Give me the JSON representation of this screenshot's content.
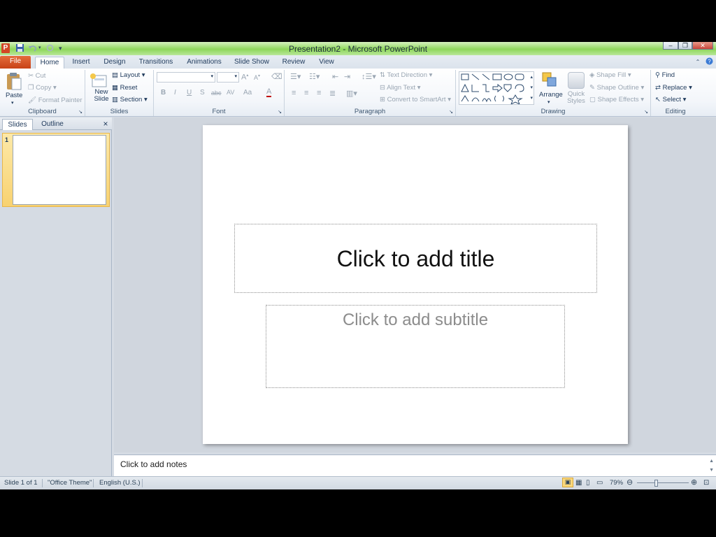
{
  "window": {
    "title": "Presentation2 - Microsoft PowerPoint"
  },
  "tabs": [
    "File",
    "Home",
    "Insert",
    "Design",
    "Transitions",
    "Animations",
    "Slide Show",
    "Review",
    "View"
  ],
  "ribbon": {
    "clipboard": {
      "label": "Clipboard",
      "paste": "Paste",
      "cut": "Cut",
      "copy": "Copy",
      "format_painter": "Format Painter"
    },
    "slides": {
      "label": "Slides",
      "new_slide": "New Slide",
      "layout": "Layout",
      "reset": "Reset",
      "section": "Section"
    },
    "font": {
      "label": "Font",
      "bold": "B",
      "italic": "I",
      "underline": "U",
      "strike": "S",
      "abc": "abc",
      "spacing": "AV",
      "case": "Aa",
      "color": "A"
    },
    "paragraph": {
      "label": "Paragraph",
      "text_direction": "Text Direction",
      "align_text": "Align Text",
      "convert_smartart": "Convert to SmartArt"
    },
    "drawing": {
      "label": "Drawing",
      "arrange": "Arrange",
      "quick_styles": "Quick Styles",
      "shape_fill": "Shape Fill",
      "shape_outline": "Shape Outline",
      "shape_effects": "Shape Effects"
    },
    "editing": {
      "label": "Editing",
      "find": "Find",
      "replace": "Replace",
      "select": "Select"
    }
  },
  "pane": {
    "tab_slides": "Slides",
    "tab_outline": "Outline",
    "close": "×",
    "slide_number": "1"
  },
  "slide": {
    "title_placeholder": "Click to add title",
    "subtitle_placeholder": "Click to add subtitle"
  },
  "notes": {
    "placeholder": "Click to add notes"
  },
  "status": {
    "slide": "Slide 1 of 1",
    "theme": "\"Office Theme\"",
    "language": "English (U.S.)",
    "zoom": "79%",
    "zoom_level": 0.79
  },
  "colors": {
    "title_bar": "#8ed75a",
    "file_tab": "#c84216",
    "thumb_highlight": "#f8d271"
  }
}
